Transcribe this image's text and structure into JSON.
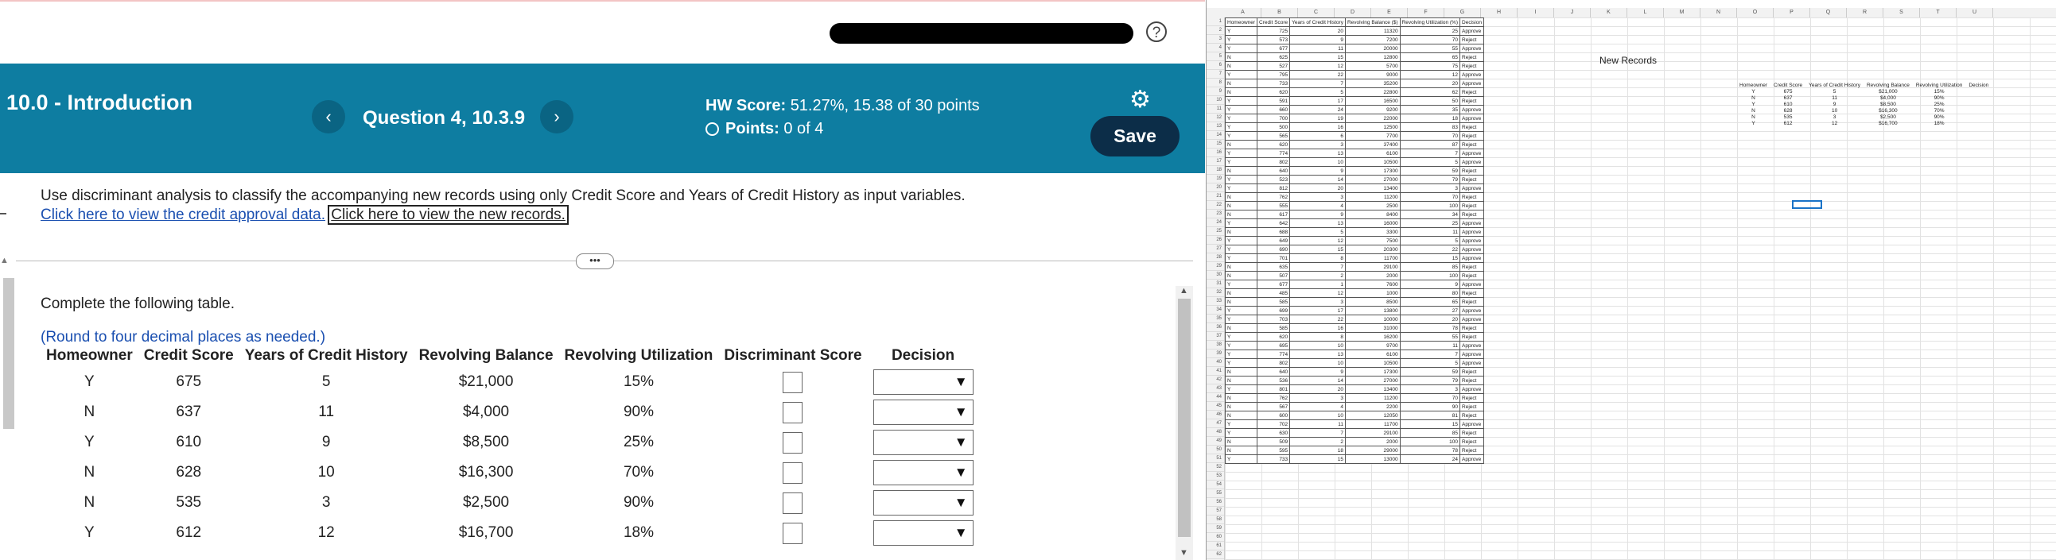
{
  "header": {
    "help_label": "?",
    "section_title": "10.0 - Introduction",
    "prev_label": "‹",
    "question_label": "Question 4, 10.3.9",
    "next_label": "›",
    "hw_score_label": "HW Score:",
    "hw_score_value": "51.27%, 15.38 of 30 points",
    "points_label": "Points:",
    "points_value": "0 of 4",
    "save_label": "Save",
    "settings_icon": "gear-icon"
  },
  "problem": {
    "instruction": "Use discriminant analysis to classify the accompanying new records using only Credit Score and Years of Credit History as input variables.",
    "link_data": "Click here to view the credit approval data.",
    "link_new": "Click here to view the new records.",
    "expander": "•••",
    "complete": "Complete the following table.",
    "round_note": "(Round to four decimal places as needed.)"
  },
  "table": {
    "headers": [
      "Homeowner",
      "Credit Score",
      "Years of Credit History",
      "Revolving Balance",
      "Revolving Utilization",
      "Discriminant Score",
      "Decision"
    ],
    "rows": [
      [
        "Y",
        "675",
        "5",
        "$21,000",
        "15%"
      ],
      [
        "N",
        "637",
        "11",
        "$4,000",
        "90%"
      ],
      [
        "Y",
        "610",
        "9",
        "$8,500",
        "25%"
      ],
      [
        "N",
        "628",
        "10",
        "$16,300",
        "70%"
      ],
      [
        "N",
        "535",
        "3",
        "$2,500",
        "90%"
      ],
      [
        "Y",
        "612",
        "12",
        "$16,700",
        "18%"
      ]
    ],
    "dropdown_icon": "▼"
  },
  "sheet": {
    "columns": [
      "A",
      "B",
      "C",
      "D",
      "E",
      "F",
      "G",
      "H",
      "I",
      "J",
      "K",
      "L",
      "M",
      "N",
      "O",
      "P",
      "Q",
      "R",
      "S",
      "T",
      "U"
    ],
    "headers": [
      "Homeowner",
      "Credit Score",
      "Years of Credit History",
      "Revolving Balance ($)",
      "Revolving Utilization (%)",
      "Decision"
    ],
    "rows": [
      [
        "Y",
        "725",
        "20",
        "11320",
        "25",
        "Approve"
      ],
      [
        "Y",
        "573",
        "9",
        "7200",
        "70",
        "Reject"
      ],
      [
        "Y",
        "677",
        "11",
        "20000",
        "55",
        "Approve"
      ],
      [
        "N",
        "625",
        "15",
        "12800",
        "65",
        "Reject"
      ],
      [
        "N",
        "527",
        "12",
        "5700",
        "75",
        "Reject"
      ],
      [
        "Y",
        "795",
        "22",
        "9000",
        "12",
        "Approve"
      ],
      [
        "N",
        "733",
        "7",
        "35200",
        "20",
        "Approve"
      ],
      [
        "N",
        "620",
        "5",
        "22800",
        "62",
        "Reject"
      ],
      [
        "Y",
        "591",
        "17",
        "16500",
        "50",
        "Reject"
      ],
      [
        "Y",
        "660",
        "24",
        "9200",
        "35",
        "Approve"
      ],
      [
        "Y",
        "700",
        "19",
        "22000",
        "18",
        "Approve"
      ],
      [
        "Y",
        "500",
        "16",
        "12500",
        "83",
        "Reject"
      ],
      [
        "Y",
        "565",
        "6",
        "7700",
        "70",
        "Reject"
      ],
      [
        "N",
        "620",
        "3",
        "37400",
        "87",
        "Reject"
      ],
      [
        "Y",
        "774",
        "13",
        "6100",
        "7",
        "Approve"
      ],
      [
        "Y",
        "802",
        "10",
        "10500",
        "5",
        "Approve"
      ],
      [
        "N",
        "640",
        "9",
        "17300",
        "59",
        "Reject"
      ],
      [
        "Y",
        "523",
        "14",
        "27000",
        "79",
        "Reject"
      ],
      [
        "Y",
        "812",
        "20",
        "13400",
        "3",
        "Approve"
      ],
      [
        "N",
        "762",
        "3",
        "11200",
        "70",
        "Reject"
      ],
      [
        "N",
        "555",
        "4",
        "2500",
        "100",
        "Reject"
      ],
      [
        "N",
        "617",
        "9",
        "8400",
        "34",
        "Reject"
      ],
      [
        "Y",
        "642",
        "13",
        "16000",
        "25",
        "Approve"
      ],
      [
        "N",
        "688",
        "5",
        "3300",
        "11",
        "Approve"
      ],
      [
        "Y",
        "649",
        "12",
        "7500",
        "5",
        "Approve"
      ],
      [
        "Y",
        "690",
        "15",
        "20300",
        "22",
        "Approve"
      ],
      [
        "Y",
        "701",
        "8",
        "11700",
        "15",
        "Approve"
      ],
      [
        "N",
        "635",
        "7",
        "29100",
        "85",
        "Reject"
      ],
      [
        "N",
        "507",
        "2",
        "2000",
        "100",
        "Reject"
      ],
      [
        "Y",
        "677",
        "1",
        "7600",
        "9",
        "Approve"
      ],
      [
        "N",
        "485",
        "12",
        "1000",
        "80",
        "Reject"
      ],
      [
        "N",
        "585",
        "3",
        "8500",
        "65",
        "Reject"
      ],
      [
        "Y",
        "699",
        "17",
        "13800",
        "27",
        "Approve"
      ],
      [
        "Y",
        "703",
        "22",
        "10000",
        "20",
        "Approve"
      ],
      [
        "N",
        "585",
        "16",
        "31000",
        "78",
        "Reject"
      ],
      [
        "Y",
        "620",
        "8",
        "16200",
        "55",
        "Reject"
      ],
      [
        "Y",
        "695",
        "10",
        "9700",
        "11",
        "Approve"
      ],
      [
        "Y",
        "774",
        "13",
        "6100",
        "7",
        "Approve"
      ],
      [
        "Y",
        "802",
        "10",
        "10500",
        "5",
        "Approve"
      ],
      [
        "N",
        "640",
        "9",
        "17300",
        "59",
        "Reject"
      ],
      [
        "N",
        "536",
        "14",
        "27000",
        "79",
        "Reject"
      ],
      [
        "Y",
        "801",
        "20",
        "13400",
        "3",
        "Approve"
      ],
      [
        "N",
        "762",
        "3",
        "11200",
        "70",
        "Reject"
      ],
      [
        "N",
        "567",
        "4",
        "2200",
        "90",
        "Reject"
      ],
      [
        "N",
        "600",
        "10",
        "12050",
        "81",
        "Reject"
      ],
      [
        "Y",
        "702",
        "11",
        "11700",
        "15",
        "Approve"
      ],
      [
        "Y",
        "630",
        "7",
        "29100",
        "85",
        "Reject"
      ],
      [
        "N",
        "509",
        "2",
        "2000",
        "100",
        "Reject"
      ],
      [
        "N",
        "595",
        "18",
        "29000",
        "78",
        "Reject"
      ],
      [
        "Y",
        "733",
        "15",
        "13000",
        "24",
        "Approve"
      ]
    ],
    "new_records_label": "New Records",
    "new_headers": [
      "Homeowner",
      "Credit Score",
      "Years of Credit History",
      "Revolving Balance",
      "Revolving Utilization",
      "Decision"
    ],
    "new_rows": [
      [
        "Y",
        "675",
        "5",
        "$21,000",
        "15%"
      ],
      [
        "N",
        "637",
        "11",
        "$4,000",
        "90%"
      ],
      [
        "Y",
        "610",
        "9",
        "$8,500",
        "25%"
      ],
      [
        "N",
        "628",
        "10",
        "$16,300",
        "70%"
      ],
      [
        "N",
        "535",
        "3",
        "$2,500",
        "90%"
      ],
      [
        "Y",
        "612",
        "12",
        "$16,700",
        "18%"
      ]
    ]
  }
}
